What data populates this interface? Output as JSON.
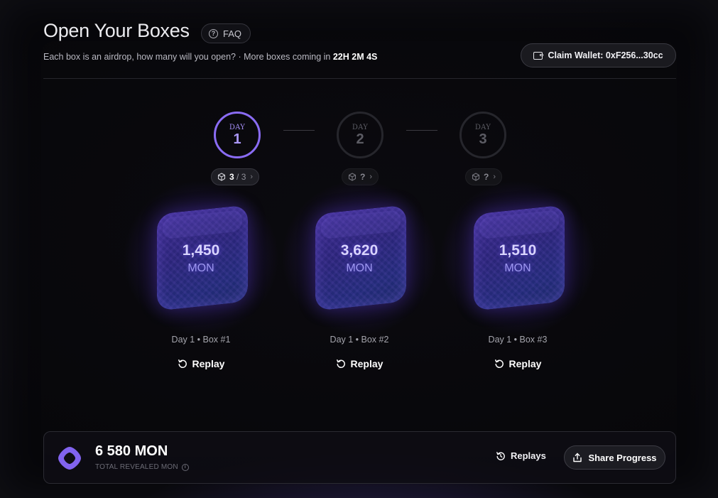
{
  "header": {
    "title": "Open Your Boxes",
    "faq_label": "FAQ",
    "subtitle_prefix": "Each box is an airdrop, how many will you open? · More boxes coming in ",
    "countdown": "22H 2M 4S",
    "claim_wallet_label": "Claim Wallet: 0xF256...30cc"
  },
  "days": [
    {
      "label": "DAY",
      "number": "1",
      "state": "active",
      "opened": "3",
      "separator": " / ",
      "total": "3"
    },
    {
      "label": "DAY",
      "number": "2",
      "state": "locked",
      "opened": "?"
    },
    {
      "label": "DAY",
      "number": "3",
      "state": "locked",
      "opened": "?"
    }
  ],
  "boxes": [
    {
      "value": "1,450",
      "unit": "MON",
      "caption": "Day 1 • Box #1",
      "replay_label": "Replay"
    },
    {
      "value": "3,620",
      "unit": "MON",
      "caption": "Day 1 • Box #2",
      "replay_label": "Replay"
    },
    {
      "value": "1,510",
      "unit": "MON",
      "caption": "Day 1 • Box #3",
      "replay_label": "Replay"
    }
  ],
  "summary": {
    "total_value": "6 580 MON",
    "total_label": "TOTAL REVEALED MON",
    "replays_label": "Replays",
    "share_label": "Share Progress"
  },
  "colors": {
    "accent": "#8a6cf4",
    "background": "#07070a",
    "box_glow": "#5f3cdc"
  }
}
